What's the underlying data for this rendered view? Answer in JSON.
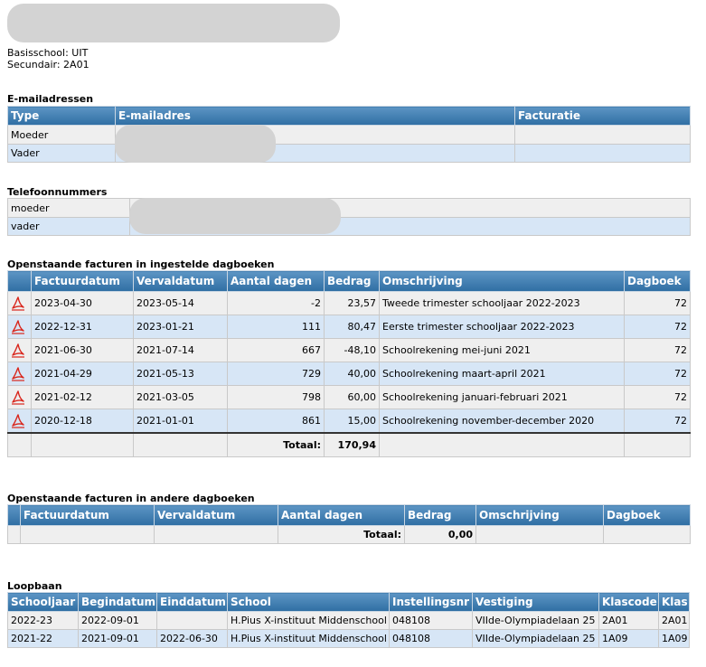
{
  "info": {
    "basisschool": "Basisschool: UIT",
    "secundair": "Secundair: 2A01"
  },
  "emails": {
    "title": "E-mailadressen",
    "headers": [
      "Type",
      "E-mailadres",
      "Facturatie"
    ],
    "rows": [
      {
        "type": "Moeder",
        "email": "",
        "facturatie": ""
      },
      {
        "type": "Vader",
        "email": "",
        "facturatie": ""
      }
    ]
  },
  "phones": {
    "title": "Telefoonnummers",
    "rows": [
      {
        "type": "moeder",
        "number": ""
      },
      {
        "type": "vader",
        "number": ""
      }
    ]
  },
  "open_invoices": {
    "title": "Openstaande facturen in ingestelde dagboeken",
    "headers": [
      "",
      "Factuurdatum",
      "Vervaldatum",
      "Aantal dagen",
      "Bedrag",
      "Omschrijving",
      "Dagboek"
    ],
    "rows": [
      {
        "factuurdatum": "2023-04-30",
        "vervaldatum": "2023-05-14",
        "dagen": "-2",
        "bedrag": "23,57",
        "omschrijving": "Tweede trimester schooljaar 2022-2023",
        "dagboek": "72"
      },
      {
        "factuurdatum": "2022-12-31",
        "vervaldatum": "2023-01-21",
        "dagen": "111",
        "bedrag": "80,47",
        "omschrijving": "Eerste trimester schooljaar 2022-2023",
        "dagboek": "72"
      },
      {
        "factuurdatum": "2021-06-30",
        "vervaldatum": "2021-07-14",
        "dagen": "667",
        "bedrag": "-48,10",
        "omschrijving": "Schoolrekening mei-juni 2021",
        "dagboek": "72"
      },
      {
        "factuurdatum": "2021-04-29",
        "vervaldatum": "2021-05-13",
        "dagen": "729",
        "bedrag": "40,00",
        "omschrijving": "Schoolrekening maart-april 2021",
        "dagboek": "72"
      },
      {
        "factuurdatum": "2021-02-12",
        "vervaldatum": "2021-03-05",
        "dagen": "798",
        "bedrag": "60,00",
        "omschrijving": "Schoolrekening januari-februari 2021",
        "dagboek": "72"
      },
      {
        "factuurdatum": "2020-12-18",
        "vervaldatum": "2021-01-01",
        "dagen": "861",
        "bedrag": "15,00",
        "omschrijving": "Schoolrekening november-december 2020",
        "dagboek": "72"
      }
    ],
    "total_label": "Totaal:",
    "total_value": "170,94",
    "icon": "pdf-icon"
  },
  "other_invoices": {
    "title": "Openstaande facturen in andere dagboeken",
    "headers": [
      "",
      "Factuurdatum",
      "Vervaldatum",
      "Aantal dagen",
      "Bedrag",
      "Omschrijving",
      "Dagboek"
    ],
    "total_label": "Totaal:",
    "total_value": "0,00"
  },
  "career": {
    "title": "Loopbaan",
    "headers": [
      "Schooljaar",
      "Begindatum",
      "Einddatum",
      "School",
      "Instellingsnr",
      "Vestiging",
      "Klascode",
      "Klas"
    ],
    "rows": [
      {
        "schooljaar": "2022-23",
        "begindatum": "2022-09-01",
        "einddatum": "",
        "school": "H.Pius X-instituut Middenschool",
        "instellingsnr": "048108",
        "vestiging": "VIIde-Olympiadelaan 25",
        "klascode": "2A01",
        "klas": "2A01"
      },
      {
        "schooljaar": "2021-22",
        "begindatum": "2021-09-01",
        "einddatum": "2022-06-30",
        "school": "H.Pius X-instituut Middenschool",
        "instellingsnr": "048108",
        "vestiging": "VIIde-Olympiadelaan 25",
        "klascode": "1A09",
        "klas": "1A09"
      }
    ]
  },
  "colors": {
    "header_top": "#5d95c4",
    "header_bottom": "#2f6ea3",
    "row_odd": "#efefef",
    "row_even": "#d7e6f6",
    "pdf_red": "#d9261c"
  }
}
